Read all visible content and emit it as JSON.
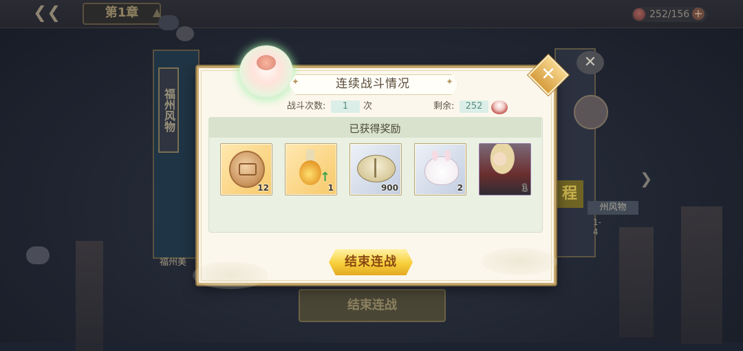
{
  "background": {
    "chapter": "第1章",
    "stamina": "252/156",
    "side_title": "福州风物",
    "side_caption": "福州美",
    "journey_label": "程",
    "location_tag": "州风物",
    "location_sub": "1-4",
    "bg_end_label": "结束连战"
  },
  "modal": {
    "title": "连续战斗情况",
    "battle_count_label": "战斗次数:",
    "battle_count_value": "1",
    "battle_count_unit": "次",
    "remaining_label": "剩余:",
    "remaining_value": "252",
    "rewards_title": "已获得奖励",
    "rewards": [
      {
        "icon": "coin-icon",
        "count": "12",
        "rarity": "gold"
      },
      {
        "icon": "potion-icon",
        "count": "1",
        "rarity": "gold"
      },
      {
        "icon": "shell-icon",
        "count": "900",
        "rarity": "blue"
      },
      {
        "icon": "bunny-icon",
        "count": "2",
        "rarity": "blue"
      },
      {
        "icon": "character-portrait-icon",
        "count": "1",
        "rarity": "purple"
      }
    ],
    "end_button": "结束连战",
    "close_symbol": "✕"
  }
}
